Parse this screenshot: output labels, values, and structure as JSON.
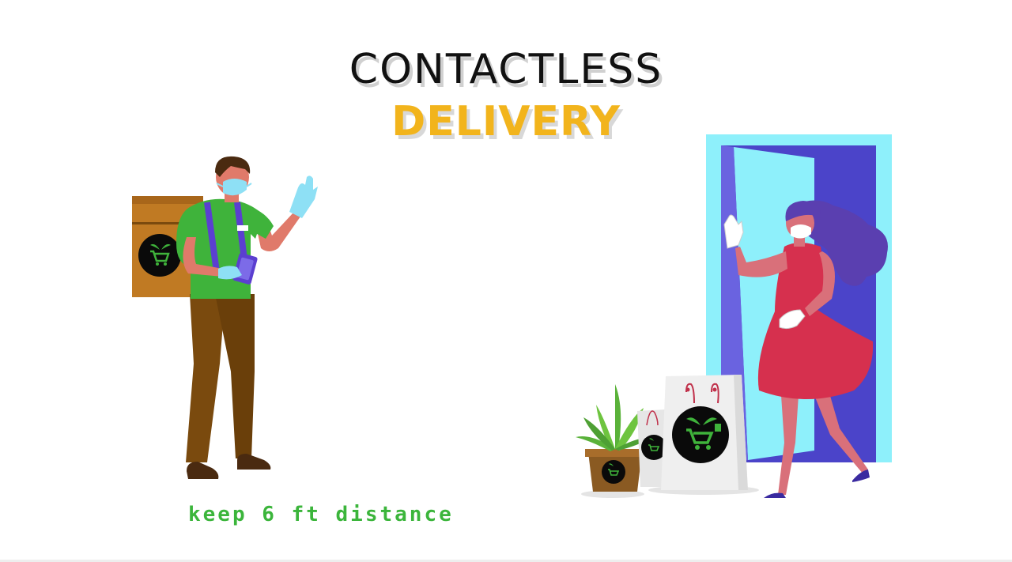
{
  "title": {
    "line1": "CONTACTLESS",
    "line2": "DELIVERY"
  },
  "caption": "keep 6 ft distance",
  "colors": {
    "title_dark": "#111111",
    "title_accent": "#f2b41c",
    "caption_green": "#3bb53b",
    "door_frame": "#8ef0fb",
    "door_inner": "#5b54d8",
    "dress_red": "#d6304e",
    "shirt_green": "#3fb33b",
    "box_brown": "#c07a23",
    "pants_brown": "#7a4a0e"
  },
  "icons": [
    "cart-leaf-logo-icon"
  ]
}
